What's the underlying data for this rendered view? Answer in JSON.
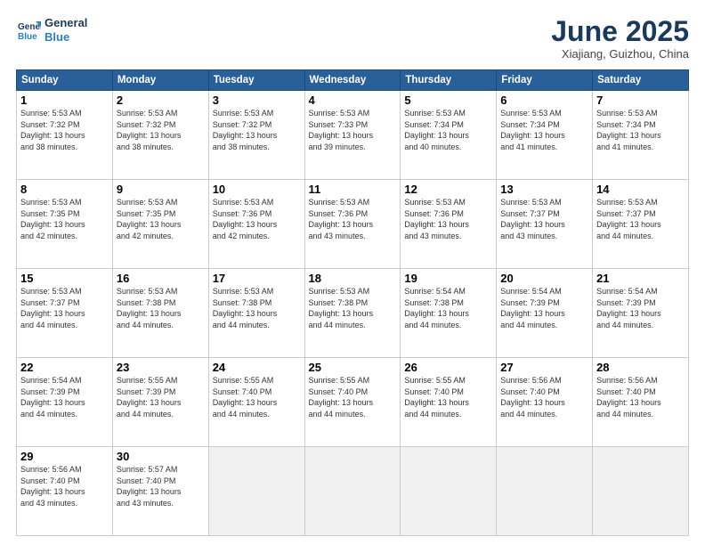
{
  "logo": {
    "line1": "General",
    "line2": "Blue"
  },
  "title": "June 2025",
  "location": "Xiajiang, Guizhou, China",
  "weekdays": [
    "Sunday",
    "Monday",
    "Tuesday",
    "Wednesday",
    "Thursday",
    "Friday",
    "Saturday"
  ],
  "weeks": [
    [
      {
        "day": 1,
        "info": "Sunrise: 5:53 AM\nSunset: 7:32 PM\nDaylight: 13 hours\nand 38 minutes."
      },
      {
        "day": 2,
        "info": "Sunrise: 5:53 AM\nSunset: 7:32 PM\nDaylight: 13 hours\nand 38 minutes."
      },
      {
        "day": 3,
        "info": "Sunrise: 5:53 AM\nSunset: 7:32 PM\nDaylight: 13 hours\nand 38 minutes."
      },
      {
        "day": 4,
        "info": "Sunrise: 5:53 AM\nSunset: 7:33 PM\nDaylight: 13 hours\nand 39 minutes."
      },
      {
        "day": 5,
        "info": "Sunrise: 5:53 AM\nSunset: 7:34 PM\nDaylight: 13 hours\nand 40 minutes."
      },
      {
        "day": 6,
        "info": "Sunrise: 5:53 AM\nSunset: 7:34 PM\nDaylight: 13 hours\nand 41 minutes."
      },
      {
        "day": 7,
        "info": "Sunrise: 5:53 AM\nSunset: 7:34 PM\nDaylight: 13 hours\nand 41 minutes."
      }
    ],
    [
      {
        "day": 8,
        "info": "Sunrise: 5:53 AM\nSunset: 7:35 PM\nDaylight: 13 hours\nand 42 minutes."
      },
      {
        "day": 9,
        "info": "Sunrise: 5:53 AM\nSunset: 7:35 PM\nDaylight: 13 hours\nand 42 minutes."
      },
      {
        "day": 10,
        "info": "Sunrise: 5:53 AM\nSunset: 7:36 PM\nDaylight: 13 hours\nand 42 minutes."
      },
      {
        "day": 11,
        "info": "Sunrise: 5:53 AM\nSunset: 7:36 PM\nDaylight: 13 hours\nand 43 minutes."
      },
      {
        "day": 12,
        "info": "Sunrise: 5:53 AM\nSunset: 7:36 PM\nDaylight: 13 hours\nand 43 minutes."
      },
      {
        "day": 13,
        "info": "Sunrise: 5:53 AM\nSunset: 7:37 PM\nDaylight: 13 hours\nand 43 minutes."
      },
      {
        "day": 14,
        "info": "Sunrise: 5:53 AM\nSunset: 7:37 PM\nDaylight: 13 hours\nand 44 minutes."
      }
    ],
    [
      {
        "day": 15,
        "info": "Sunrise: 5:53 AM\nSunset: 7:37 PM\nDaylight: 13 hours\nand 44 minutes."
      },
      {
        "day": 16,
        "info": "Sunrise: 5:53 AM\nSunset: 7:38 PM\nDaylight: 13 hours\nand 44 minutes."
      },
      {
        "day": 17,
        "info": "Sunrise: 5:53 AM\nSunset: 7:38 PM\nDaylight: 13 hours\nand 44 minutes."
      },
      {
        "day": 18,
        "info": "Sunrise: 5:53 AM\nSunset: 7:38 PM\nDaylight: 13 hours\nand 44 minutes."
      },
      {
        "day": 19,
        "info": "Sunrise: 5:54 AM\nSunset: 7:38 PM\nDaylight: 13 hours\nand 44 minutes."
      },
      {
        "day": 20,
        "info": "Sunrise: 5:54 AM\nSunset: 7:39 PM\nDaylight: 13 hours\nand 44 minutes."
      },
      {
        "day": 21,
        "info": "Sunrise: 5:54 AM\nSunset: 7:39 PM\nDaylight: 13 hours\nand 44 minutes."
      }
    ],
    [
      {
        "day": 22,
        "info": "Sunrise: 5:54 AM\nSunset: 7:39 PM\nDaylight: 13 hours\nand 44 minutes."
      },
      {
        "day": 23,
        "info": "Sunrise: 5:55 AM\nSunset: 7:39 PM\nDaylight: 13 hours\nand 44 minutes."
      },
      {
        "day": 24,
        "info": "Sunrise: 5:55 AM\nSunset: 7:40 PM\nDaylight: 13 hours\nand 44 minutes."
      },
      {
        "day": 25,
        "info": "Sunrise: 5:55 AM\nSunset: 7:40 PM\nDaylight: 13 hours\nand 44 minutes."
      },
      {
        "day": 26,
        "info": "Sunrise: 5:55 AM\nSunset: 7:40 PM\nDaylight: 13 hours\nand 44 minutes."
      },
      {
        "day": 27,
        "info": "Sunrise: 5:56 AM\nSunset: 7:40 PM\nDaylight: 13 hours\nand 44 minutes."
      },
      {
        "day": 28,
        "info": "Sunrise: 5:56 AM\nSunset: 7:40 PM\nDaylight: 13 hours\nand 44 minutes."
      }
    ],
    [
      {
        "day": 29,
        "info": "Sunrise: 5:56 AM\nSunset: 7:40 PM\nDaylight: 13 hours\nand 43 minutes."
      },
      {
        "day": 30,
        "info": "Sunrise: 5:57 AM\nSunset: 7:40 PM\nDaylight: 13 hours\nand 43 minutes."
      },
      {
        "day": null,
        "info": ""
      },
      {
        "day": null,
        "info": ""
      },
      {
        "day": null,
        "info": ""
      },
      {
        "day": null,
        "info": ""
      },
      {
        "day": null,
        "info": ""
      }
    ]
  ]
}
